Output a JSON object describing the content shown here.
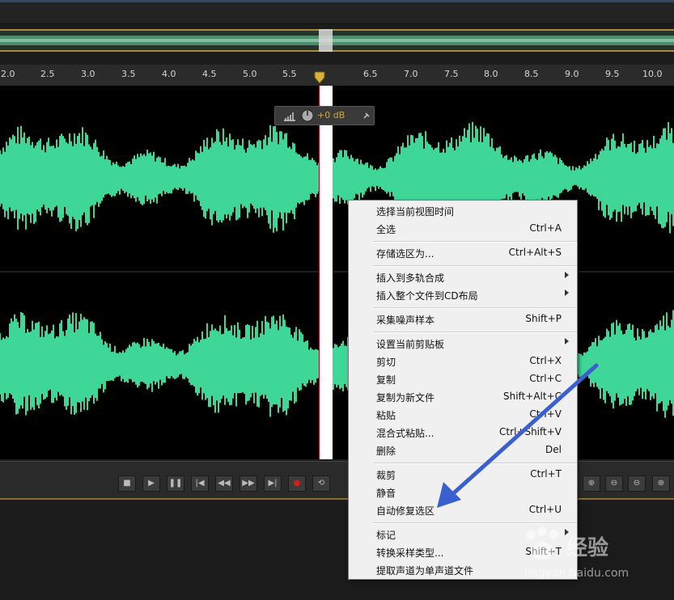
{
  "ruler": {
    "ticks": [
      "2.0",
      "2.5",
      "3.0",
      "3.5",
      "4.0",
      "4.5",
      "5.0",
      "5.5",
      "6.5",
      "7.0",
      "7.5",
      "8.0",
      "8.5",
      "9.0",
      "9.5",
      "10.0"
    ]
  },
  "hud": {
    "gain": "+0 dB"
  },
  "transport": {
    "buttons": [
      "stop",
      "play",
      "pause",
      "go-to-start",
      "rewind",
      "fast-forward",
      "go-to-end",
      "record",
      "loop"
    ]
  },
  "context_menu": {
    "items": [
      {
        "label": "选择当前视图时间",
        "shortcut": ""
      },
      {
        "label": "全选",
        "shortcut": "Ctrl+A"
      },
      {
        "label": "存储选区为...",
        "shortcut": "Ctrl+Alt+S"
      },
      {
        "label": "插入到多轨合成",
        "shortcut": "",
        "submenu": true
      },
      {
        "label": "插入整个文件到CD布局",
        "shortcut": "",
        "submenu": true
      },
      {
        "label": "采集噪声样本",
        "shortcut": "Shift+P"
      },
      {
        "label": "设置当前剪贴板",
        "shortcut": "",
        "submenu": true
      },
      {
        "label": "剪切",
        "shortcut": "Ctrl+X"
      },
      {
        "label": "复制",
        "shortcut": "Ctrl+C"
      },
      {
        "label": "复制为新文件",
        "shortcut": "Shift+Alt+C"
      },
      {
        "label": "粘贴",
        "shortcut": "Ctrl+V"
      },
      {
        "label": "混合式粘贴...",
        "shortcut": "Ctrl+Shift+V"
      },
      {
        "label": "删除",
        "shortcut": "Del"
      },
      {
        "label": "裁剪",
        "shortcut": "Ctrl+T"
      },
      {
        "label": "静音",
        "shortcut": ""
      },
      {
        "label": "自动修复选区",
        "shortcut": "Ctrl+U"
      },
      {
        "label": "标记",
        "shortcut": "",
        "submenu": true
      },
      {
        "label": "转换采样类型...",
        "shortcut": "Shift+T"
      },
      {
        "label": "提取声道为单声道文件",
        "shortcut": ""
      }
    ]
  },
  "watermark": {
    "brand": "经验",
    "url": "jingyan.baidu.com"
  },
  "colors": {
    "waveform": "#3fd797",
    "arrow": "#3a5fcf",
    "menu_bg": "#f0f0f0"
  }
}
